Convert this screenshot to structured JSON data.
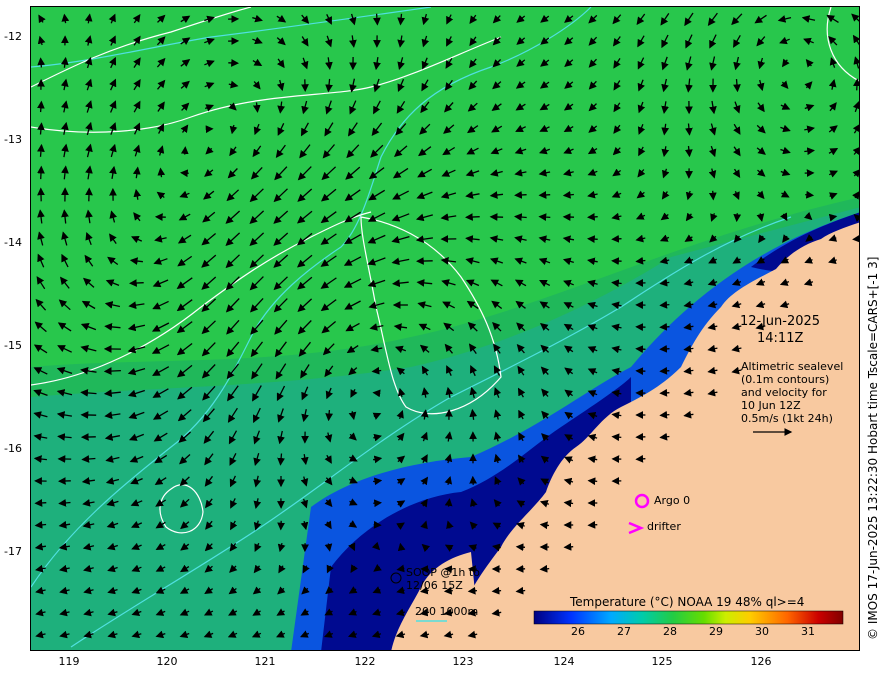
{
  "map": {
    "axis": {
      "lat_ticks": [
        "-12",
        "-13",
        "-14",
        "-15",
        "-16",
        "-17"
      ],
      "lon_ticks": [
        "119",
        "120",
        "121",
        "122",
        "123",
        "124",
        "125",
        "126"
      ]
    },
    "annotations": {
      "date": "12-Jun-2025",
      "time": "14:11Z",
      "legend_lines": [
        "Altimetric sealevel",
        "(0.1m contours)",
        "and velocity for",
        "10 Jun 12Z",
        "0.5m/s (1kt 24h)"
      ],
      "argo_label": "Argo 0",
      "drifter_label": "drifter",
      "soop_line1": "SOOP @1h to",
      "soop_line2": "12/06 15Z",
      "depth_label": "200  1000m"
    },
    "colorbar": {
      "title": "Temperature (°C) NOAA 19 48% ql>=4",
      "ticks": [
        "26",
        "27",
        "28",
        "29",
        "30",
        "31"
      ],
      "colors": [
        "#000080",
        "#0033ff",
        "#00aaff",
        "#00ccaa",
        "#22cc44",
        "#66dd00",
        "#ccee00",
        "#ffcc00",
        "#ff6600",
        "#cc0000",
        "#800000"
      ]
    },
    "side_credit": "© IMOS 17-Jun-2025 13:22:30 Hobart time Tscale=CARS+[-1 3]",
    "colors": {
      "land": "#f8c9a0",
      "sea_warm": "#22c04a",
      "sea_mid": "#1fb08a",
      "sea_cool": "#0a50e0",
      "sea_cold": "#000a90",
      "contour": "#ffffff",
      "bathy": "#50e0e0",
      "marker": "#ff00ff"
    }
  }
}
